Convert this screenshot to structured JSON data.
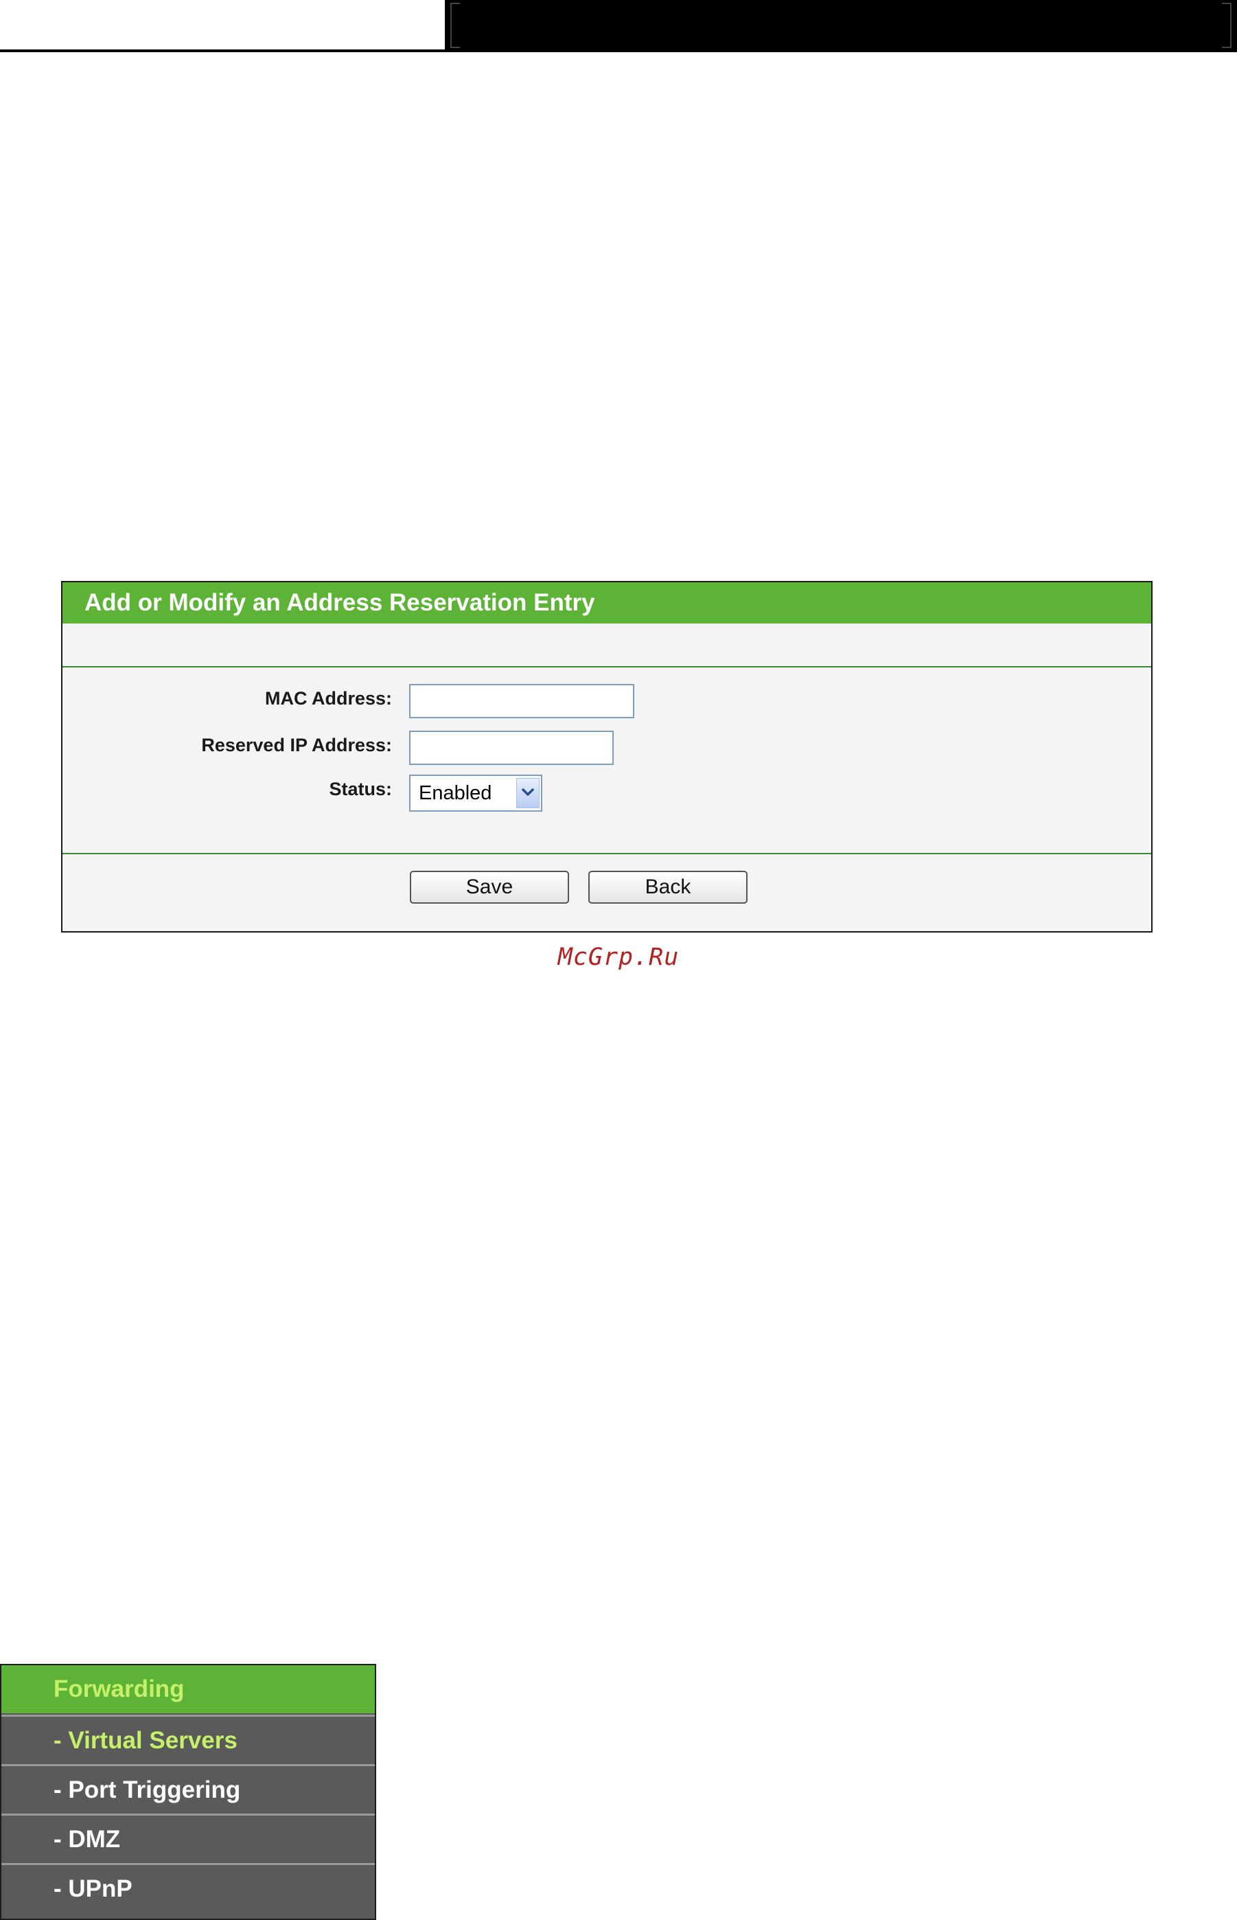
{
  "form": {
    "title": "Add or Modify an Address Reservation Entry",
    "fields": {
      "mac_label": "MAC Address:",
      "mac_value": "",
      "ip_label": "Reserved IP Address:",
      "ip_value": "",
      "status_label": "Status:",
      "status_value": "Enabled"
    },
    "buttons": {
      "save": "Save",
      "back": "Back"
    }
  },
  "watermark": "McGrp.Ru",
  "menu": {
    "parent": "Forwarding",
    "items": [
      {
        "label": "- Virtual Servers",
        "active": true
      },
      {
        "label": "- Port Triggering",
        "active": false
      },
      {
        "label": "- DMZ",
        "active": false
      },
      {
        "label": "- UPnP",
        "active": false
      }
    ]
  },
  "colors": {
    "header_green": "#5db336",
    "menu_gray": "#5a5a5a",
    "menu_active_text": "#c6f06a",
    "watermark": "#b22222"
  },
  "icons": {
    "select_arrow": "chevron-down-icon"
  }
}
